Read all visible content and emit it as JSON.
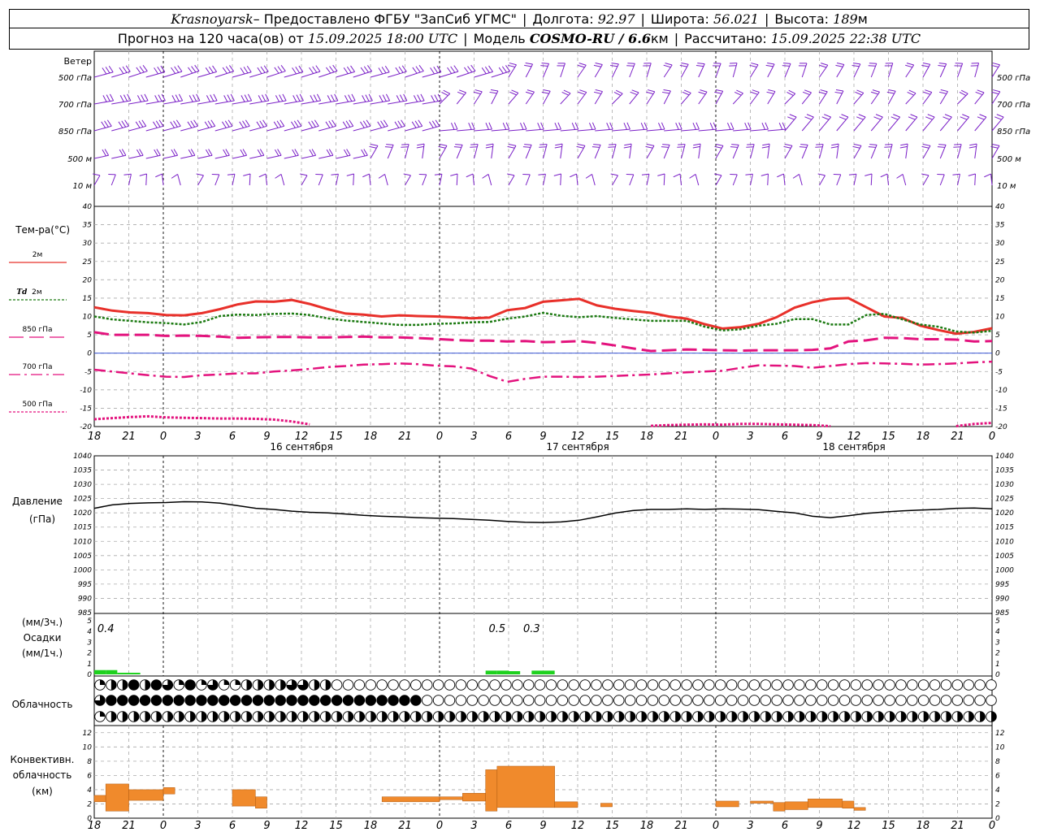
{
  "header": {
    "station": "Krasnoyarsk",
    "provider": " – Предоставлено ФГБУ \"ЗапСиб УГМС\"",
    "lon_label": "Долгота:",
    "lon": "92.97",
    "lat_label": "Широта:",
    "lat": "56.021",
    "alt_label": "Высота:",
    "alt": "189",
    "alt_unit": "м",
    "forecast_label": "Прогноз на 120 часа(ов) от",
    "run_time": "15.09.2025 18:00 UTC",
    "model_label": "Модель",
    "model": "COSMO-RU / 6.6",
    "model_unit": "км",
    "computed_label": "Рассчитано:",
    "computed_time": "15.09.2025 22:38 UTC"
  },
  "chart_data": [
    {
      "type": "wind-barbs",
      "title": "Ветер",
      "levels": [
        "500 гПа",
        "700 гПа",
        "850 гПа",
        "500 м",
        "10  м"
      ],
      "color": "#7a1fc7"
    },
    {
      "type": "line",
      "ylabel": "Тем-ра(°C)",
      "ylim": [
        -20,
        40
      ],
      "yticks": [
        40,
        35,
        30,
        25,
        20,
        15,
        10,
        5,
        0,
        -5,
        -10,
        -15,
        -20
      ],
      "x_hours": [
        0,
        6,
        12,
        18,
        24,
        30,
        36,
        42,
        48,
        54,
        60,
        66,
        72,
        78,
        84,
        90,
        96,
        102,
        108,
        114,
        120,
        126,
        132,
        138,
        144,
        150,
        156,
        162,
        168,
        174,
        180,
        186,
        192,
        198,
        204,
        210,
        216,
        222,
        228,
        234,
        240,
        246,
        252,
        258,
        264,
        270,
        276,
        282,
        288
      ],
      "series": [
        {
          "name": "2м",
          "color": "#e8302a",
          "dash": "",
          "width": 3,
          "values": [
            12.5,
            11.6,
            11.1,
            10.9,
            10.4,
            10.3,
            10.9,
            12.0,
            13.3,
            14.1,
            14.0,
            14.5,
            13.4,
            12.0,
            10.8,
            10.5,
            10.0,
            10.3,
            10.1,
            10.0,
            9.8,
            9.5,
            9.7,
            11.7,
            12.3,
            14.0,
            14.4,
            14.8,
            13.0,
            12.1,
            11.5,
            11.0,
            10.0,
            9.4,
            7.9,
            6.7,
            7.1,
            8.0,
            9.8,
            12.4,
            13.9,
            14.8,
            15.0,
            12.5,
            10.0,
            9.6,
            7.5,
            6.3,
            5.3,
            5.8,
            6.8
          ]
        },
        {
          "name": "Td  2м",
          "color": "#1c7a12",
          "dash": "3,2",
          "width": 2.5,
          "values": [
            10.0,
            9.2,
            8.8,
            8.4,
            8.2,
            7.8,
            8.5,
            10.1,
            10.5,
            10.4,
            10.7,
            10.8,
            10.4,
            9.5,
            8.9,
            8.5,
            8.1,
            7.7,
            7.7,
            8.0,
            8.1,
            8.4,
            8.5,
            9.4,
            10.0,
            11.0,
            10.2,
            9.8,
            10.1,
            9.6,
            9.2,
            8.8,
            8.8,
            8.8,
            7.2,
            6.2,
            6.5,
            7.5,
            8.0,
            9.3,
            9.3,
            7.8,
            7.8,
            10.4,
            10.7,
            9.2,
            7.8,
            7.2,
            5.9,
            5.6,
            6.1
          ]
        },
        {
          "name": "850 гПа",
          "color": "#e3127d",
          "dash": "18,7",
          "width": 3,
          "values": [
            5.7,
            5.0,
            5.0,
            5.0,
            4.7,
            4.8,
            4.7,
            4.5,
            4.2,
            4.3,
            4.4,
            4.4,
            4.3,
            4.3,
            4.4,
            4.5,
            4.3,
            4.3,
            4.1,
            3.9,
            3.6,
            3.4,
            3.4,
            3.2,
            3.3,
            3.0,
            3.1,
            3.3,
            2.8,
            2.1,
            1.3,
            0.6,
            0.8,
            1.0,
            0.9,
            0.8,
            0.7,
            0.8,
            0.8,
            0.8,
            0.9,
            1.3,
            3.2,
            3.5,
            4.2,
            4.1,
            3.8,
            3.8,
            3.7,
            3.2,
            3.3
          ]
        },
        {
          "name": "700 гПа",
          "color": "#e3127d",
          "dash": "14,5,3,5",
          "width": 2.5,
          "values": [
            -4.5,
            -5.0,
            -5.5,
            -6.0,
            -6.4,
            -6.5,
            -6.0,
            -5.8,
            -5.5,
            -5.5,
            -5.0,
            -4.7,
            -4.3,
            -3.8,
            -3.5,
            -3.1,
            -3.0,
            -2.8,
            -3.0,
            -3.4,
            -3.6,
            -4.2,
            -6.2,
            -7.8,
            -7.0,
            -6.4,
            -6.4,
            -6.5,
            -6.4,
            -6.2,
            -6.0,
            -5.8,
            -5.5,
            -5.2,
            -5.0,
            -4.8,
            -4.0,
            -3.3,
            -3.4,
            -3.5,
            -4.0,
            -3.5,
            -3.0,
            -2.7,
            -2.8,
            -2.9,
            -3.1,
            -3.0,
            -2.8,
            -2.5,
            -2.3
          ]
        },
        {
          "name": "500 гПа",
          "color": "#e3127d",
          "dash": "3,2",
          "width": 3,
          "values": [
            -18.0,
            -17.7,
            -17.4,
            -17.2,
            -17.5,
            -17.6,
            -17.7,
            -17.8,
            -17.8,
            -17.9,
            -18.1,
            -18.6,
            -19.4,
            -20.2,
            -20.5,
            -20.7,
            -20.8,
            -21.0,
            -21.1,
            -21.0,
            -21.0,
            -21.1,
            -21.2,
            -21.3,
            -21.2,
            -21.1,
            -21.1,
            -21.0,
            -20.7,
            -20.6,
            -20.4,
            -19.8,
            -19.6,
            -19.5,
            -19.4,
            -19.5,
            -19.3,
            -19.3,
            -19.4,
            -19.5,
            -19.6,
            -19.9,
            -20.4,
            -20.9,
            -20.9,
            -20.6,
            -20.4,
            -20.1,
            -19.9,
            -19.3,
            -19.0
          ]
        }
      ]
    },
    {
      "type": "line",
      "ylabel": "Давление",
      "ylabel2": "(гПа)",
      "ylim": [
        985,
        1040
      ],
      "yticks": [
        1040,
        1035,
        1030,
        1025,
        1020,
        1015,
        1010,
        1005,
        1000,
        995,
        990,
        985
      ],
      "series": [
        {
          "name": "",
          "color": "#000000",
          "values": [
            1021.6,
            1022.8,
            1023.3,
            1023.5,
            1023.6,
            1023.9,
            1023.8,
            1023.4,
            1022.5,
            1021.6,
            1021.2,
            1020.6,
            1020.2,
            1020.0,
            1019.6,
            1019.1,
            1018.8,
            1018.6,
            1018.3,
            1018.1,
            1018.0,
            1017.7,
            1017.4,
            1017.0,
            1016.7,
            1016.6,
            1016.8,
            1017.4,
            1018.6,
            1019.9,
            1020.8,
            1021.2,
            1021.2,
            1021.4,
            1021.2,
            1021.4,
            1021.3,
            1021.1,
            1020.5,
            1020.0,
            1018.8,
            1018.3,
            1019.0,
            1019.8,
            1020.3,
            1020.7,
            1021.0,
            1021.2,
            1021.6,
            1021.7,
            1021.4
          ]
        }
      ]
    },
    {
      "type": "bar",
      "ylabel": "(мм/3ч.)",
      "ylabel2": "Осадки",
      "ylabel3": "(мм/1ч.)",
      "ylim": [
        0,
        5
      ],
      "yticks": [
        5,
        4,
        3,
        2,
        1,
        0
      ],
      "color": "#1ed11e",
      "bars": [
        {
          "hour": 0,
          "value": 0.4
        },
        {
          "hour": 1,
          "value": 0.4
        },
        {
          "hour": 2,
          "value": 0.15
        },
        {
          "hour": 3,
          "value": 0.15
        },
        {
          "hour": 34,
          "value": 0.35
        },
        {
          "hour": 35,
          "value": 0.35
        },
        {
          "hour": 36,
          "value": 0.3
        },
        {
          "hour": 38,
          "value": 0.35
        },
        {
          "hour": 39,
          "value": 0.35
        }
      ],
      "labels": [
        {
          "hour": 1,
          "text": "0.4"
        },
        {
          "hour": 35,
          "text": "0.5"
        },
        {
          "hour": 38,
          "text": "0.3"
        }
      ]
    },
    {
      "type": "symbols",
      "ylabel": "Облачность",
      "rows": [
        "1224243141311222233220000000000000000000000000000000000000000000000000000000000000000000000000",
        "3444444444444444444444444444400000000000000000000000000000000000000000000000000000000000000000",
        "1222222222222222222222222222222222222222222222222222222222222222222222222222222222222222222222"
      ]
    },
    {
      "type": "bar",
      "ylabel": "Конвективн.",
      "ylabel2": "облачность",
      "ylabel3": "(км)",
      "ylim": [
        0,
        13
      ],
      "yticks": [
        12,
        10,
        8,
        6,
        4,
        2,
        0
      ],
      "color": "#f08a2c",
      "bars": [
        {
          "h0": 0,
          "h1": 1,
          "base": 2.3,
          "top": 3.2
        },
        {
          "h0": 1,
          "h1": 3,
          "base": 1.0,
          "top": 4.8
        },
        {
          "h0": 3,
          "h1": 6,
          "base": 2.5,
          "top": 4.0
        },
        {
          "h0": 6,
          "h1": 7,
          "base": 3.4,
          "top": 4.3
        },
        {
          "h0": 12,
          "h1": 14,
          "base": 1.7,
          "top": 4.0
        },
        {
          "h0": 14,
          "h1": 15,
          "base": 1.4,
          "top": 3.0
        },
        {
          "h0": 25,
          "h1": 30,
          "base": 2.3,
          "top": 3.0
        },
        {
          "h0": 30,
          "h1": 32,
          "base": 2.6,
          "top": 3.0
        },
        {
          "h0": 32,
          "h1": 34,
          "base": 2.4,
          "top": 3.5
        },
        {
          "h0": 34,
          "h1": 35,
          "base": 1.0,
          "top": 6.8
        },
        {
          "h0": 35,
          "h1": 40,
          "base": 1.5,
          "top": 7.3
        },
        {
          "h0": 40,
          "h1": 42,
          "base": 1.5,
          "top": 2.3
        },
        {
          "h0": 44,
          "h1": 45,
          "base": 1.6,
          "top": 2.1
        },
        {
          "h0": 54,
          "h1": 56,
          "base": 1.6,
          "top": 2.4
        },
        {
          "h0": 57,
          "h1": 59,
          "base": 2.1,
          "top": 2.4
        },
        {
          "h0": 59,
          "h1": 60,
          "base": 1.0,
          "top": 2.2
        },
        {
          "h0": 60,
          "h1": 62,
          "base": 1.2,
          "top": 2.3
        },
        {
          "h0": 62,
          "h1": 65,
          "base": 1.5,
          "top": 2.7
        },
        {
          "h0": 65,
          "h1": 66,
          "base": 1.4,
          "top": 2.4
        },
        {
          "h0": 66,
          "h1": 67,
          "base": 1.1,
          "top": 1.5
        }
      ]
    }
  ],
  "time_axis": {
    "ticks": [
      "18",
      "21",
      "0",
      "3",
      "6",
      "9",
      "12",
      "15",
      "18",
      "21",
      "0",
      "3",
      "6",
      "9",
      "12",
      "15",
      "18",
      "21",
      "0",
      "3",
      "6",
      "9",
      "12",
      "15",
      "18",
      "21",
      "0"
    ],
    "days": [
      {
        "label": "16 сентября",
        "hour": 18
      },
      {
        "label": "17 сентября",
        "hour": 42
      },
      {
        "label": "18 сентября",
        "hour": 66
      }
    ]
  },
  "legend": {
    "t2m": "2м",
    "td_prefix": "Td",
    "td2m": "2м",
    "t850": "850 гПа",
    "t700": "700 гПа",
    "t500": "500 гПа"
  }
}
